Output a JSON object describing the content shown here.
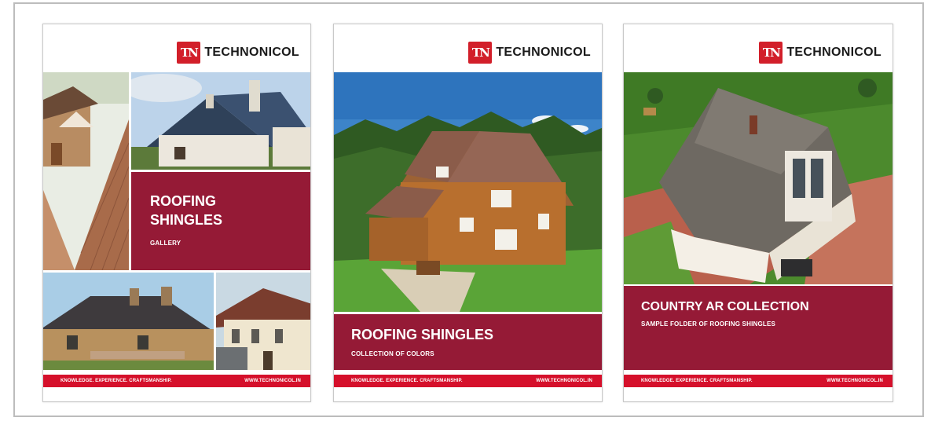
{
  "brand": {
    "logo_mark": "TN",
    "logo_text": "TECHNONICOL"
  },
  "brochures": [
    {
      "title_line1": "ROOFING",
      "title_line2": "SHINGLES",
      "subtitle": "GALLERY",
      "footer_left": "KNOWLEDGE. EXPERIENCE. CRAFTSMANSHIP.",
      "footer_right": "WWW.TECHNONICOL.IN"
    },
    {
      "title": "ROOFING SHINGLES",
      "subtitle": "COLLECTION OF COLORS",
      "footer_left": "KNOWLEDGE. EXPERIENCE. CRAFTSMANSHIP.",
      "footer_right": "WWW.TECHNONICOL.IN"
    },
    {
      "title": "COUNTRY AR COLLECTION",
      "subtitle": "SAMPLE FOLDER OF ROOFING SHINGLES",
      "footer_left": "KNOWLEDGE. EXPERIENCE. CRAFTSMANSHIP.",
      "footer_right": "WWW.TECHNONICOL.IN"
    }
  ],
  "colors": {
    "brand_red": "#d21f2a",
    "panel_red": "#951a36",
    "footer_red": "#d5102b"
  }
}
